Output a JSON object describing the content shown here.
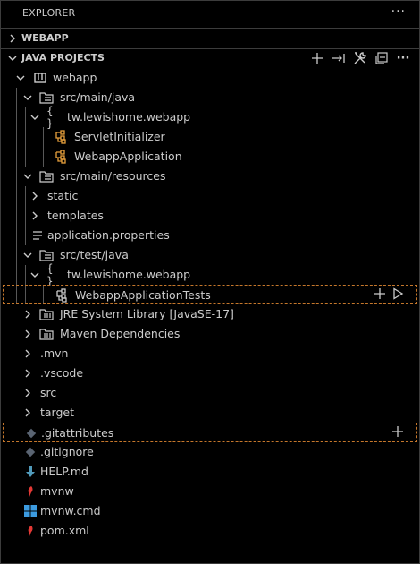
{
  "titlebar": {
    "title": "EXPLORER",
    "more_icon": "ellipsis-icon"
  },
  "sections": {
    "webapp": {
      "label": "WEBAPP",
      "expanded": false
    },
    "java_projects": {
      "label": "JAVA PROJECTS",
      "expanded": true,
      "actions": [
        "add-icon",
        "link-icon",
        "tools-icon",
        "collapse-all-icon",
        "more-icon"
      ]
    }
  },
  "tree": [
    {
      "label": "webapp",
      "icon": "project-icon",
      "expanded": true
    },
    {
      "label": "src/main/java",
      "icon": "package-folder-icon",
      "expanded": true
    },
    {
      "label": "tw.lewishome.webapp",
      "icon": "namespace-braces-icon",
      "expanded": true
    },
    {
      "label": "ServletInitializer",
      "icon": "class-icon"
    },
    {
      "label": "WebappApplication",
      "icon": "class-icon"
    },
    {
      "label": "src/main/resources",
      "icon": "package-folder-icon",
      "expanded": true
    },
    {
      "label": "static",
      "expanded": false
    },
    {
      "label": "templates",
      "expanded": false
    },
    {
      "label": "application.properties",
      "icon": "properties-file-icon"
    },
    {
      "label": "src/test/java",
      "icon": "package-folder-icon",
      "expanded": true
    },
    {
      "label": "tw.lewishome.webapp",
      "icon": "namespace-braces-icon",
      "expanded": true
    },
    {
      "label": "WebappApplicationTests",
      "icon": "test-class-icon",
      "hover_actions": [
        "add-icon",
        "run-icon"
      ]
    },
    {
      "label": "JRE System Library [JavaSE-17]",
      "icon": "library-folder-icon",
      "expanded": false
    },
    {
      "label": "Maven Dependencies",
      "icon": "library-folder-icon",
      "expanded": false
    },
    {
      "label": ".mvn",
      "expanded": false
    },
    {
      "label": ".vscode",
      "expanded": false
    },
    {
      "label": "src",
      "expanded": false
    },
    {
      "label": "target",
      "expanded": false
    },
    {
      "label": ".gitattributes",
      "icon": "git-file-icon",
      "hover_actions": [
        "add-icon"
      ]
    },
    {
      "label": ".gitignore",
      "icon": "git-file-icon"
    },
    {
      "label": "HELP.md",
      "icon": "markdown-icon"
    },
    {
      "label": "mvnw",
      "icon": "maven-icon"
    },
    {
      "label": "mvnw.cmd",
      "icon": "windows-icon"
    },
    {
      "label": "pom.xml",
      "icon": "maven-icon"
    }
  ],
  "colors": {
    "accent_orange": "#e8a03c",
    "focus_border": "#c5772b",
    "markdown_blue": "#519aba",
    "maven_red": "#e53935",
    "windows_blue": "#3c9be0"
  }
}
